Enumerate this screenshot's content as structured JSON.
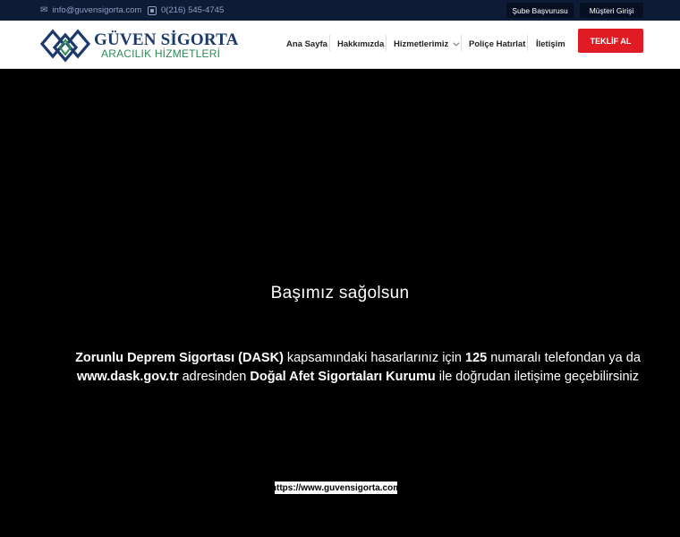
{
  "topbar": {
    "email": "info@guvensigorta.com",
    "phone": "0(216) 545-4745",
    "sube_button": "Şube Başvurusu",
    "musteri_button": "Müşteri Girişi"
  },
  "logo": {
    "title": "GÜVEN SİGORTA",
    "subtitle": "ARACILIK HİZMETLERİ"
  },
  "nav": {
    "items": [
      {
        "label": "Ana Sayfa"
      },
      {
        "label": "Hakkımızda"
      },
      {
        "label": "Hizmetlerimiz"
      },
      {
        "label": "Poliçe Hatırlat"
      },
      {
        "label": "İletişim"
      }
    ],
    "cta": "TEKLİF AL"
  },
  "hero": {
    "title": "Başımız sağolsun",
    "p1_bold": "Zorunlu Deprem Sigortası (DASK)",
    "p2": " kapsamındaki hasarlarınız için ",
    "p3_bold": "125",
    "p4": " numaralı telefondan ya da",
    "p5_bold": "www.dask.gov.tr",
    "p6": " adresinden ",
    "p7_bold": "Doğal Afet Sigortaları Kurumu",
    "p8": " ile doğrudan iletişime geçebilirsiniz",
    "url": "https://www.guvensigorta.com"
  },
  "colors": {
    "topbar_bg": "#0d1b36",
    "brand_blue": "#1b3a6b",
    "brand_green": "#2e8a57",
    "cta_red": "#e01b24"
  },
  "icons": [
    "mail-icon",
    "phone-icon",
    "chevron-down-icon"
  ]
}
